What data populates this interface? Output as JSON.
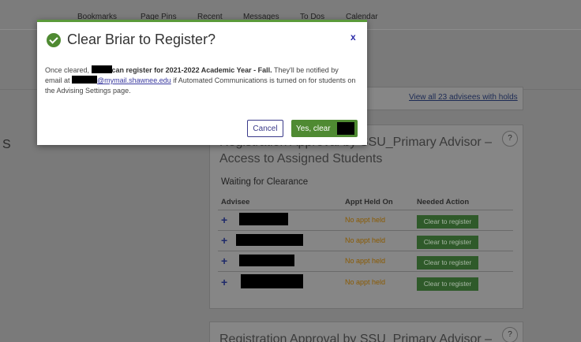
{
  "nav": {
    "items": [
      "Bookmarks",
      "Page Pins",
      "Recent",
      "Messages",
      "To Dos",
      "Calendar"
    ]
  },
  "side_letter": "S",
  "holds_link": "View all 23 advisees with holds",
  "help_label": "?",
  "card1": {
    "title": "Registration Approval by SSU_Primary Advisor – Access to Assigned Students",
    "section": "Waiting for Clearance",
    "columns": [
      "Advisee",
      "Appt Held On",
      "Needed Action"
    ],
    "rows": [
      {
        "expand": "+",
        "appt": "No appt held",
        "action": "Clear to register"
      },
      {
        "expand": "+",
        "appt": "No appt held",
        "action": "Clear to register"
      },
      {
        "expand": "+",
        "appt": "No appt held",
        "action": "Clear to register"
      },
      {
        "expand": "+",
        "appt": "No appt held",
        "action": "Clear to register"
      }
    ]
  },
  "card2": {
    "title": "Registration Approval by SSU_Primary Advisor –"
  },
  "modal": {
    "title": "Clear Briar to Register?",
    "close": "x",
    "body_1": "Once cleared,",
    "body_bold": "can register for 2021-2022 Academic Year - Fall.",
    "body_2": " They'll be notified by email at",
    "email_domain": "@mymail.shawnee.edu",
    "body_3": " if Automated Communications is turned on for students on the Advising Settings page.",
    "cancel": "Cancel",
    "confirm": "Yes, clear"
  },
  "colors": {
    "accent_green": "#4f8a32",
    "overlay_gray": "#7a7a7a",
    "link_blue": "#3a3aa0"
  }
}
